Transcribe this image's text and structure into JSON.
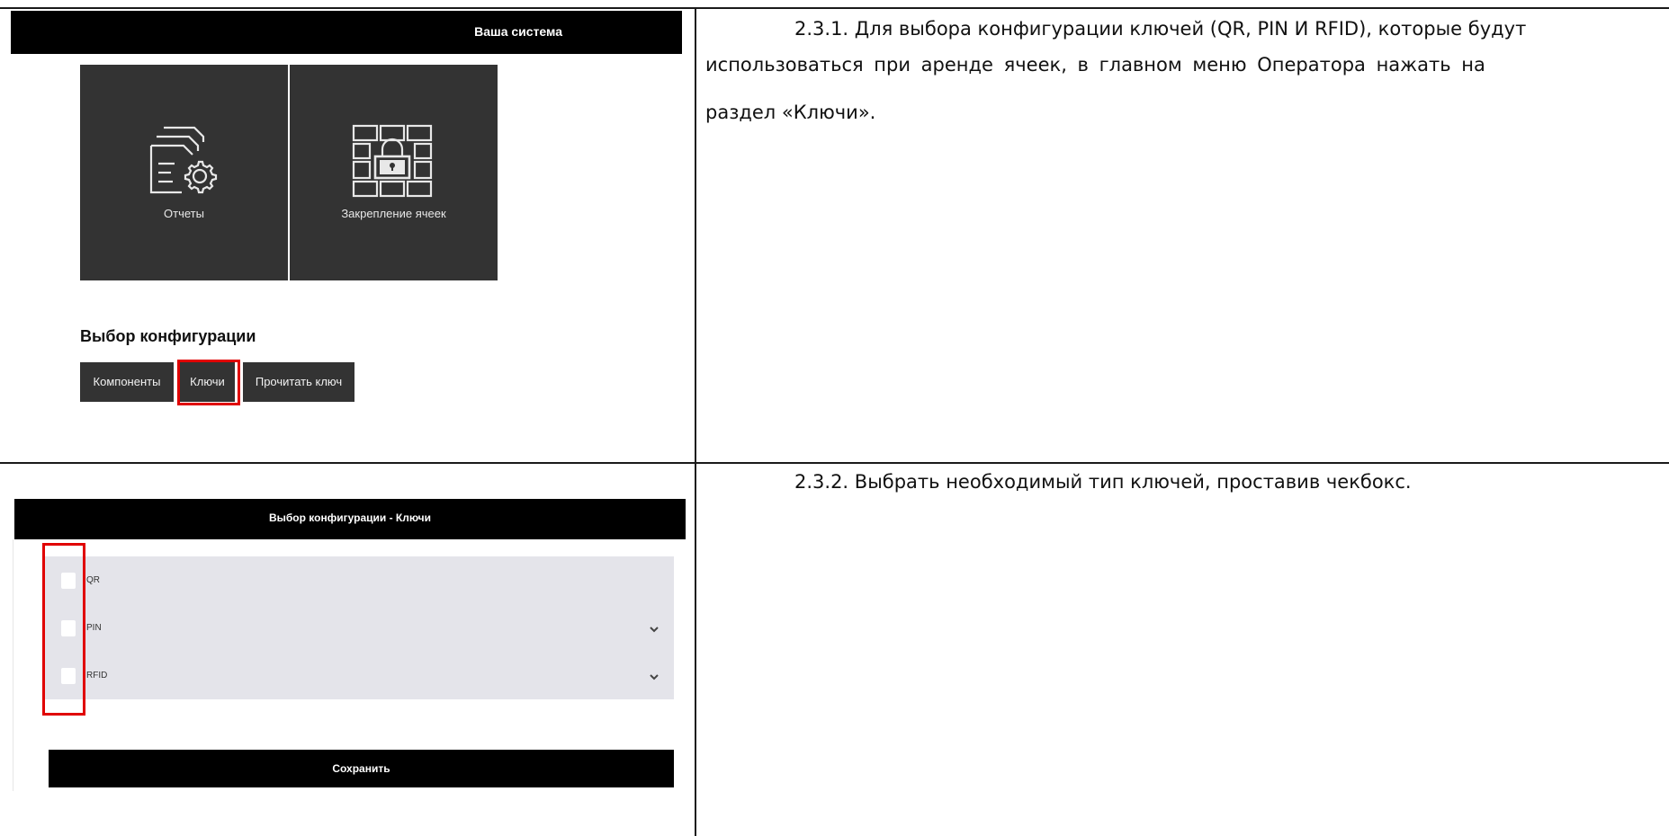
{
  "top_screenshot": {
    "header_title": "Ваша система",
    "tiles": [
      {
        "label": "Отчеты",
        "icon": "report-settings-icon"
      },
      {
        "label": "Закрепление ячеек",
        "icon": "cell-lock-icon"
      }
    ],
    "section_title": "Выбор конфигурации",
    "buttons": [
      "Компоненты",
      "Ключи",
      "Прочитать ключ"
    ],
    "highlighted_button": "Ключи",
    "highlight_color": "#e00000"
  },
  "bottom_screenshot": {
    "header_title": "Выбор конфигурации - Ключи",
    "keys": [
      {
        "label": "QR",
        "checked": false,
        "expandable": false
      },
      {
        "label": "PIN",
        "checked": false,
        "expandable": true
      },
      {
        "label": "RFID",
        "checked": false,
        "expandable": true
      }
    ],
    "save_label": "Сохранить",
    "highlight_color": "#e00000"
  },
  "instructions": {
    "step_1_line1": "2.3.1. Для выбора конфигурации ключей (QR, PIN И RFID), которые будут",
    "step_1_line2": "использоваться при аренде ячеек, в главном меню Оператора нажать на",
    "step_1_line3": "раздел «Ключи».",
    "step_2": "2.3.2. Выбрать необходимый тип ключей, проставив чекбокс."
  }
}
